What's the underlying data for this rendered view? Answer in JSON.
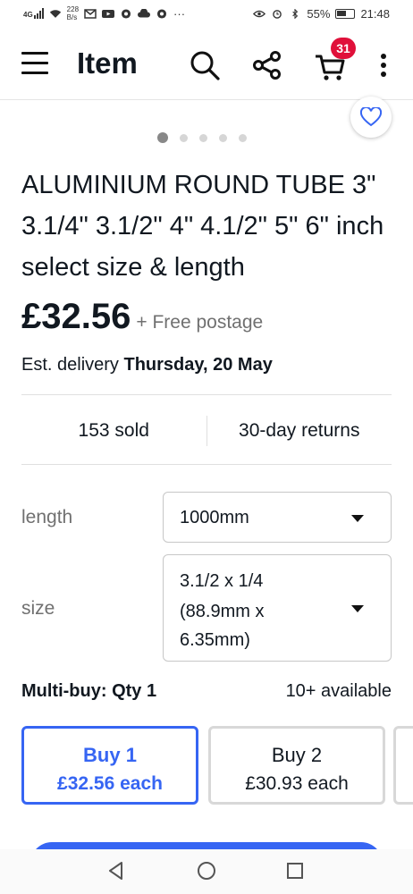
{
  "status": {
    "network": "4G",
    "net_speed": "228",
    "net_unit": "B/s",
    "more": "···",
    "battery": "55%",
    "time": "21:48"
  },
  "header": {
    "title": "Item",
    "cart_count": "31",
    "icons": [
      "menu-icon",
      "search-icon",
      "share-icon",
      "cart-icon",
      "more-vert-icon"
    ]
  },
  "gallery": {
    "dot_count": 5,
    "active_index": 0
  },
  "product": {
    "title": "ALUMINIUM ROUND TUBE 3\" 3.1/4\" 3.1/2\" 4\" 4.1/2\" 5\" 6\" inch select size & length",
    "price": "£32.56",
    "postage": "+ Free postage",
    "delivery_prefix": "Est. delivery ",
    "delivery_date": "Thursday, 20 May",
    "sold": "153 sold",
    "returns": "30-day returns"
  },
  "options": {
    "length_label": "length",
    "length_value": "1000mm",
    "size_label": "size",
    "size_value_line1": "3.1/2 x 1/4",
    "size_value_line2": "(88.9mm x",
    "size_value_line3": "6.35mm)"
  },
  "multibuy": {
    "label": "Multi-buy: Qty 1",
    "available": "10+ available",
    "tiers": [
      {
        "title": "Buy 1",
        "price": "£32.56 each"
      },
      {
        "title": "Buy 2",
        "price": "£30.93 each"
      }
    ]
  },
  "colors": {
    "accent": "#3665f3",
    "badge": "#e0103a",
    "text": "#111820",
    "muted": "#707070"
  }
}
